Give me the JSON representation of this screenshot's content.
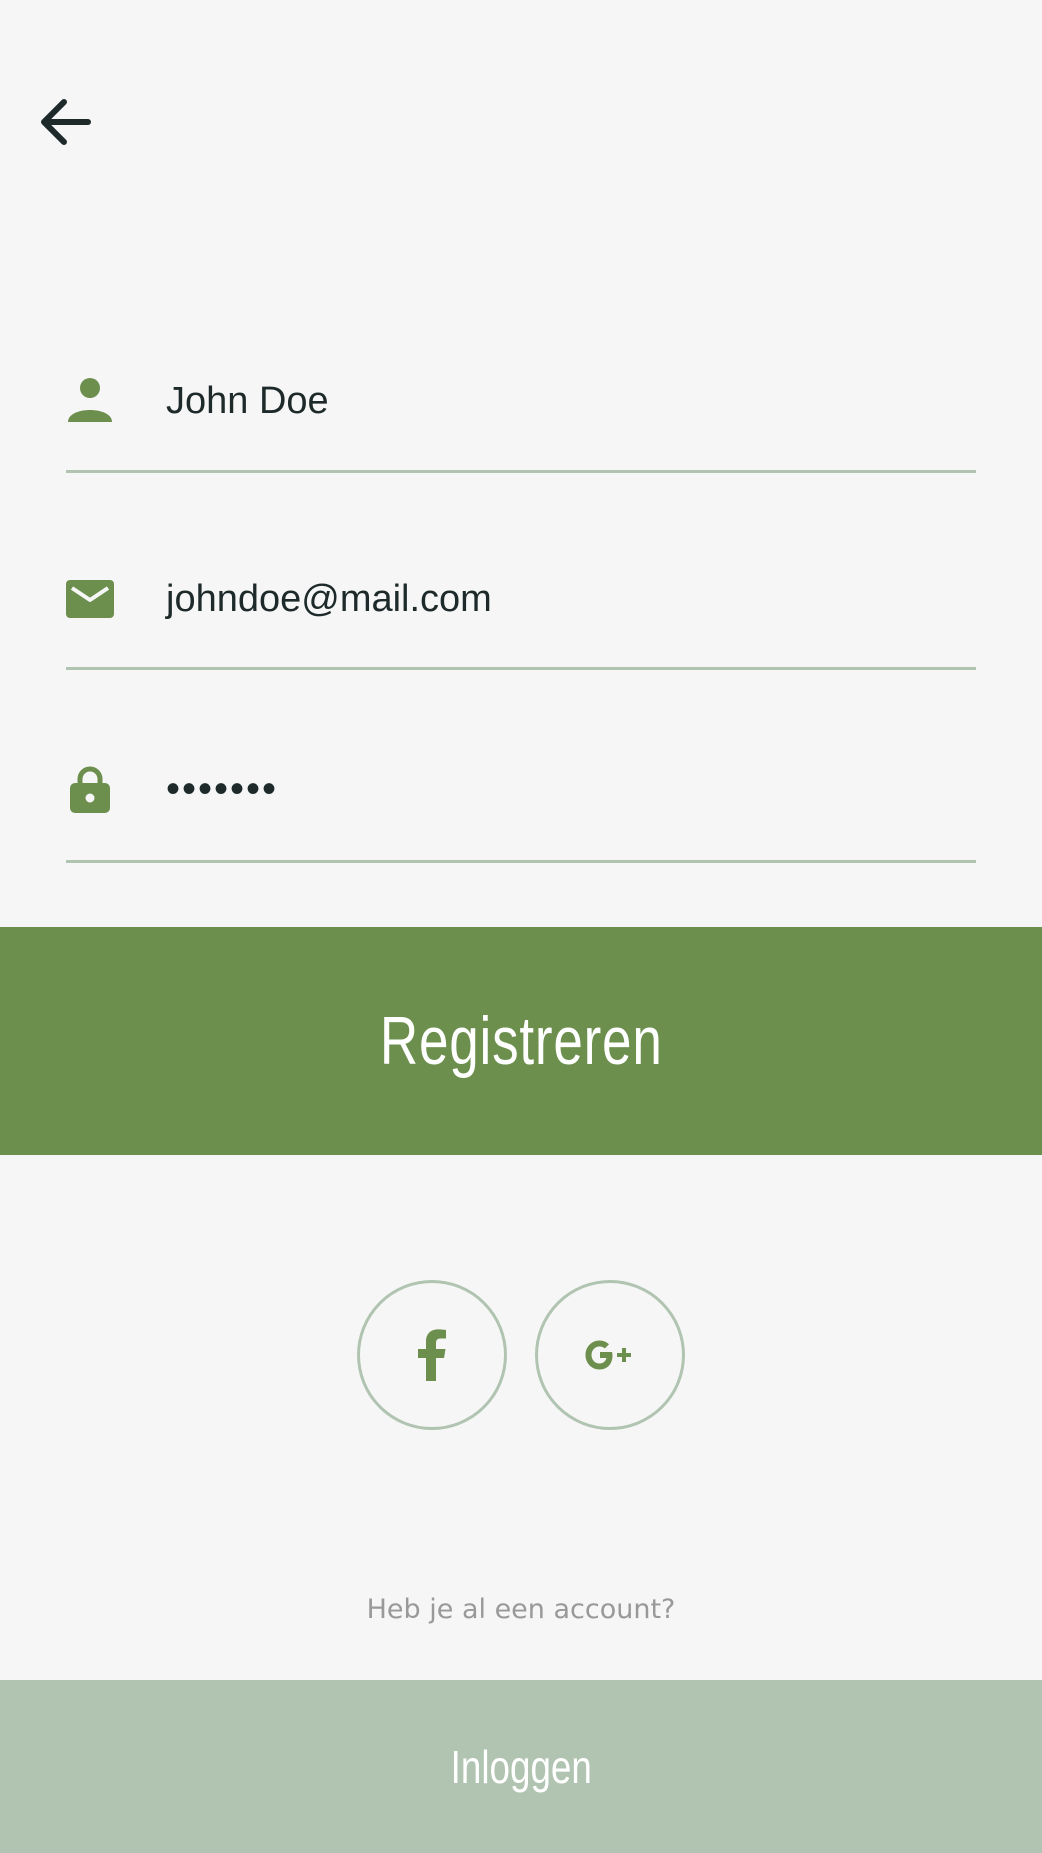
{
  "colors": {
    "background": "#f6f6f6",
    "accent_green": "#6d8f4e",
    "light_green": "#b0c4b1",
    "text_dark": "#1e2a2a",
    "text_muted": "#999999"
  },
  "nav": {
    "back_icon": "arrow-left-icon"
  },
  "form": {
    "name": {
      "icon": "person-icon",
      "value": "John Doe"
    },
    "email": {
      "icon": "mail-icon",
      "value": "johndoe@mail.com"
    },
    "password": {
      "icon": "lock-icon",
      "value": "•••••••"
    }
  },
  "register_button": {
    "label": "Registreren"
  },
  "social": {
    "facebook_icon": "facebook-icon",
    "google_icon": "google-plus-icon"
  },
  "footer": {
    "have_account_text": "Heb je al een account?",
    "login_label": "Inloggen"
  }
}
